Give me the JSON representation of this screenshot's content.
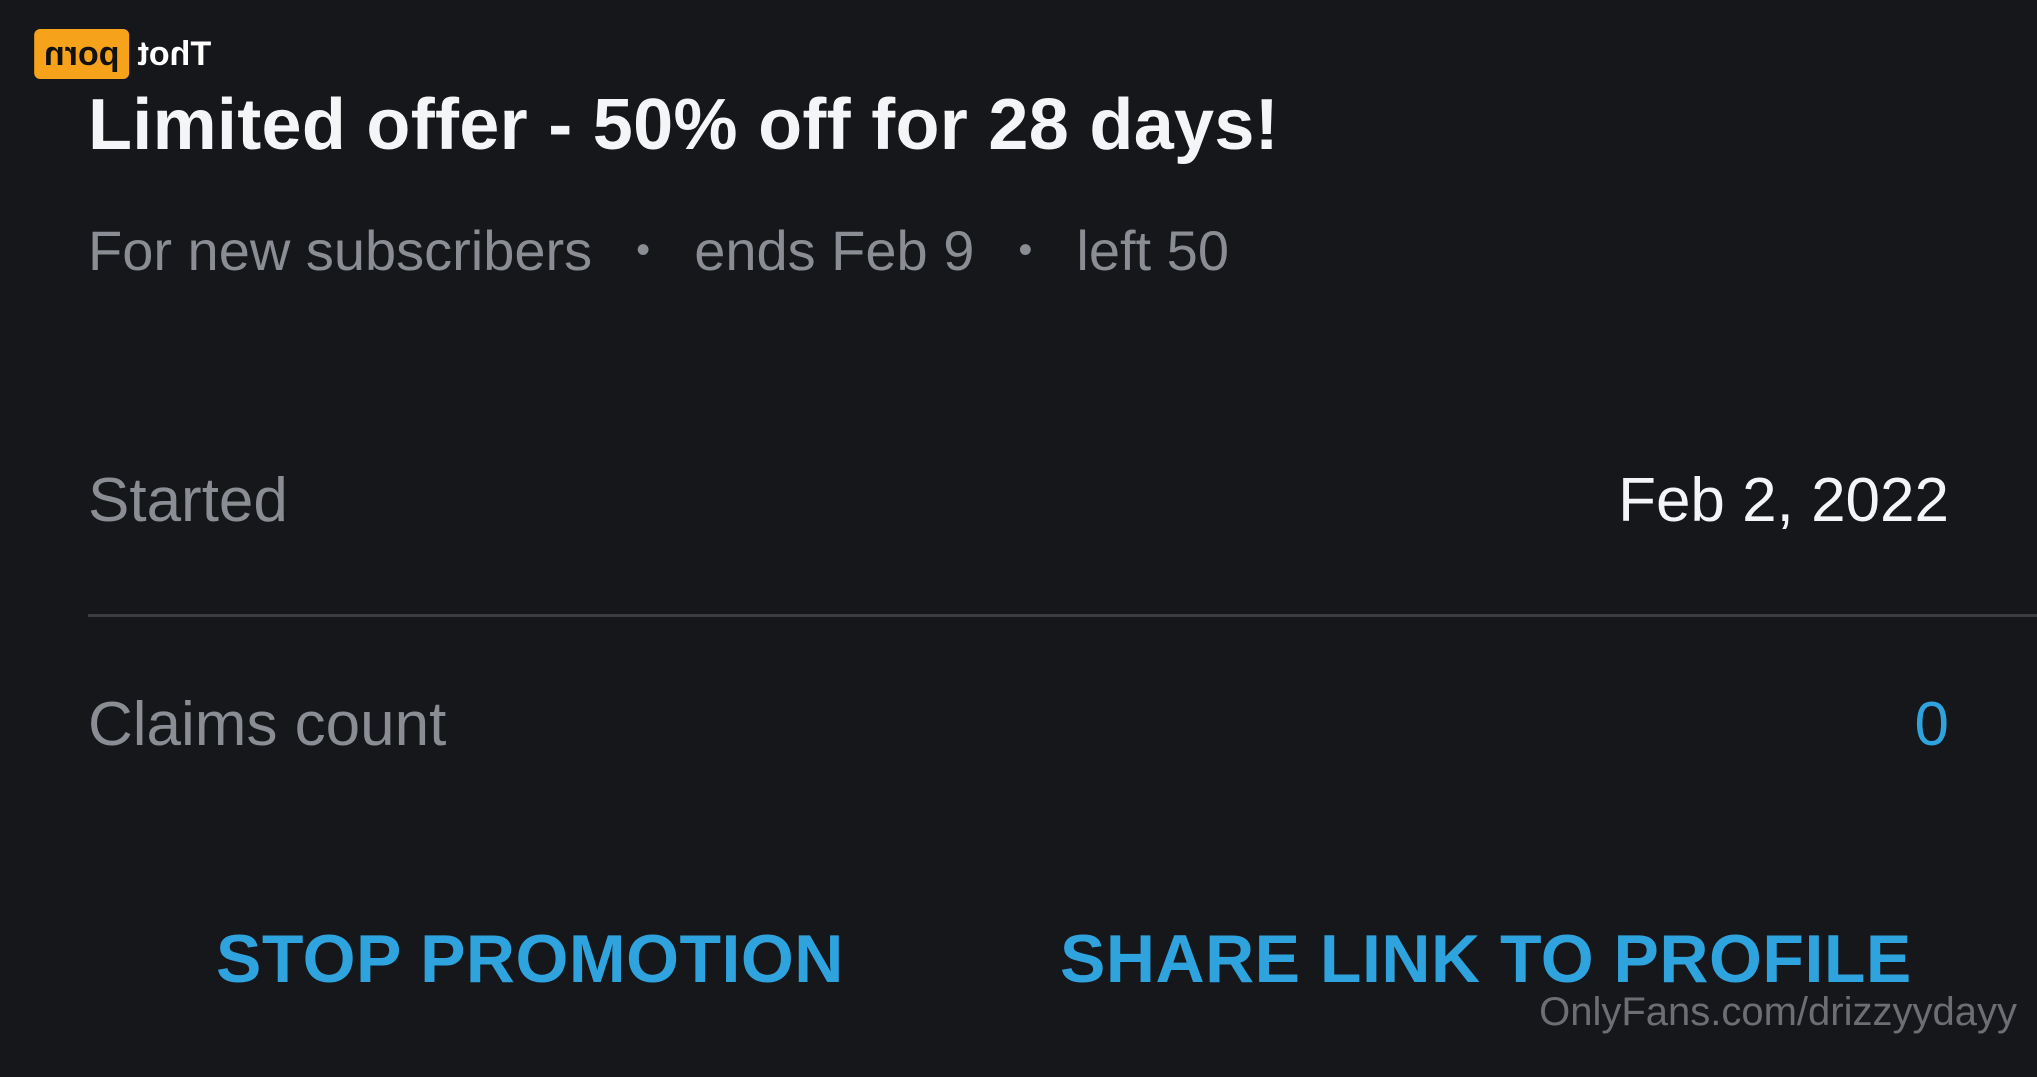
{
  "watermark_logo": {
    "white_text": "Thot",
    "box_text": "porn"
  },
  "offer": {
    "title": "Limited offer - 50% off for 28 days!",
    "audience": "For new subscribers",
    "separator": "•",
    "ends": "ends Feb 9",
    "left": "left 50"
  },
  "details": {
    "started_label": "Started",
    "started_value": "Feb 2, 2022",
    "claims_label": "Claims count",
    "claims_value": "0"
  },
  "actions": {
    "stop_label": "STOP PROMOTION",
    "share_label": "SHARE LINK TO PROFILE"
  },
  "footer_watermark": "OnlyFans.com/drizzyydayy",
  "colors": {
    "background": "#16171a",
    "accent": "#2fa3dd",
    "muted_text": "#8a8d93",
    "primary_text": "#f4f5f6",
    "logo_orange": "#f7a21b"
  }
}
